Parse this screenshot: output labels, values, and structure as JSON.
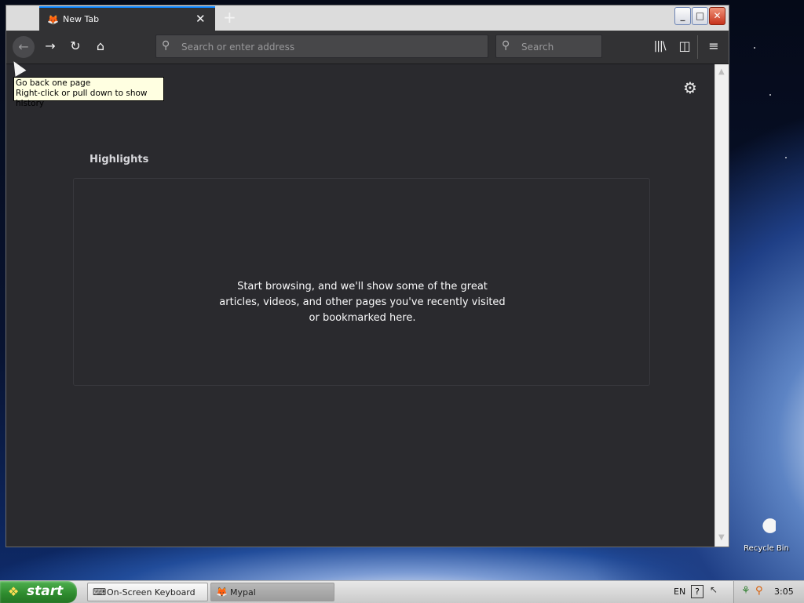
{
  "desktop": {
    "recycle_bin_label": "Recycle Bin"
  },
  "browser": {
    "tab": {
      "title": "New Tab",
      "favicon": "mypal-icon"
    },
    "window_controls": {
      "minimize": "_",
      "maximize": "□",
      "close": "✕"
    },
    "urlbar": {
      "placeholder": "Search or enter address",
      "value": ""
    },
    "searchbar": {
      "placeholder": "Search",
      "value": ""
    },
    "tooltip": {
      "line1": "Go back one page",
      "line2": "Right-click or pull down to show history"
    },
    "content": {
      "highlights_title": "Highlights",
      "empty_message": "Start browsing, and we'll show some of the great articles, videos, and other pages you've recently visited or bookmarked here."
    },
    "icons": {
      "back": "←",
      "forward": "→",
      "reload": "↻",
      "home": "⌂",
      "library": "|||\\",
      "sidebar": "◫",
      "menu": "≡",
      "gear": "⚙",
      "search": "⚲",
      "new_tab": "+",
      "tab_close": "✕"
    },
    "colors": {
      "chrome": "#323234",
      "content_bg": "#2a2a2e",
      "tab_accent": "#0a84ff"
    }
  },
  "taskbar": {
    "start_label": "start",
    "tasks": [
      {
        "label": "On-Screen Keyboard",
        "icon": "keyboard-icon",
        "active": false
      },
      {
        "label": "Mypal",
        "icon": "mypal-icon",
        "active": true
      }
    ],
    "language": "EN",
    "help": "?",
    "clock": "3:05"
  }
}
